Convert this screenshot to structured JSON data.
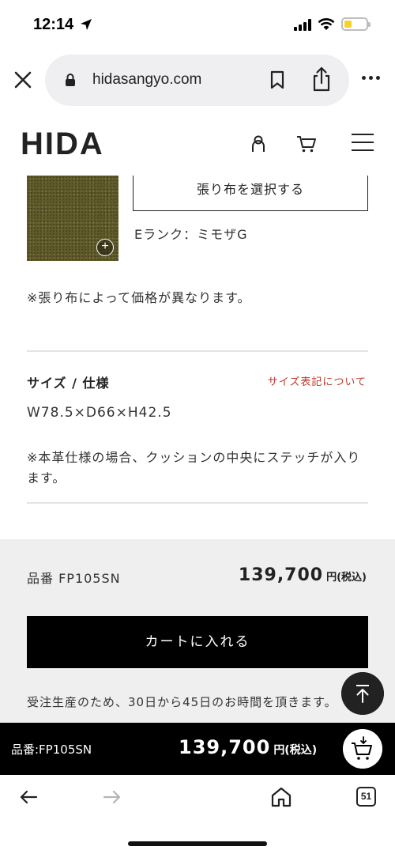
{
  "status_bar": {
    "time": "12:14"
  },
  "browser": {
    "url": "hidasangyo.com",
    "tab_count": "51"
  },
  "header": {
    "logo": "HIDA"
  },
  "fabric": {
    "select_label": "張り布を選択する",
    "selected_name": "Eランク：ミモザG",
    "zoom_symbol": "+",
    "price_note": "※張り布によって価格が異なります。"
  },
  "size": {
    "heading": "サイズ / 仕様",
    "link": "サイズ表記について",
    "dimensions": "W78.5×D66×H42.5",
    "note": "※本革仕様の場合、クッションの中央にステッチが入ります。"
  },
  "purchase": {
    "product_code": "品番 FP105SN",
    "price": "139,700",
    "price_unit": "円(税込)",
    "add_to_cart": "カートに入れる",
    "lead_time": "受注生産のため、30日から45日のお時間を頂きます。"
  },
  "sticky": {
    "product_code": "品番:FP105SN",
    "price": "139,700",
    "price_unit": "円(税込)"
  },
  "colors": {
    "accent_link": "#c0392b",
    "panel_bg": "#efefef",
    "button_bg": "#000000",
    "fabric_color": "#5f5a2c"
  }
}
